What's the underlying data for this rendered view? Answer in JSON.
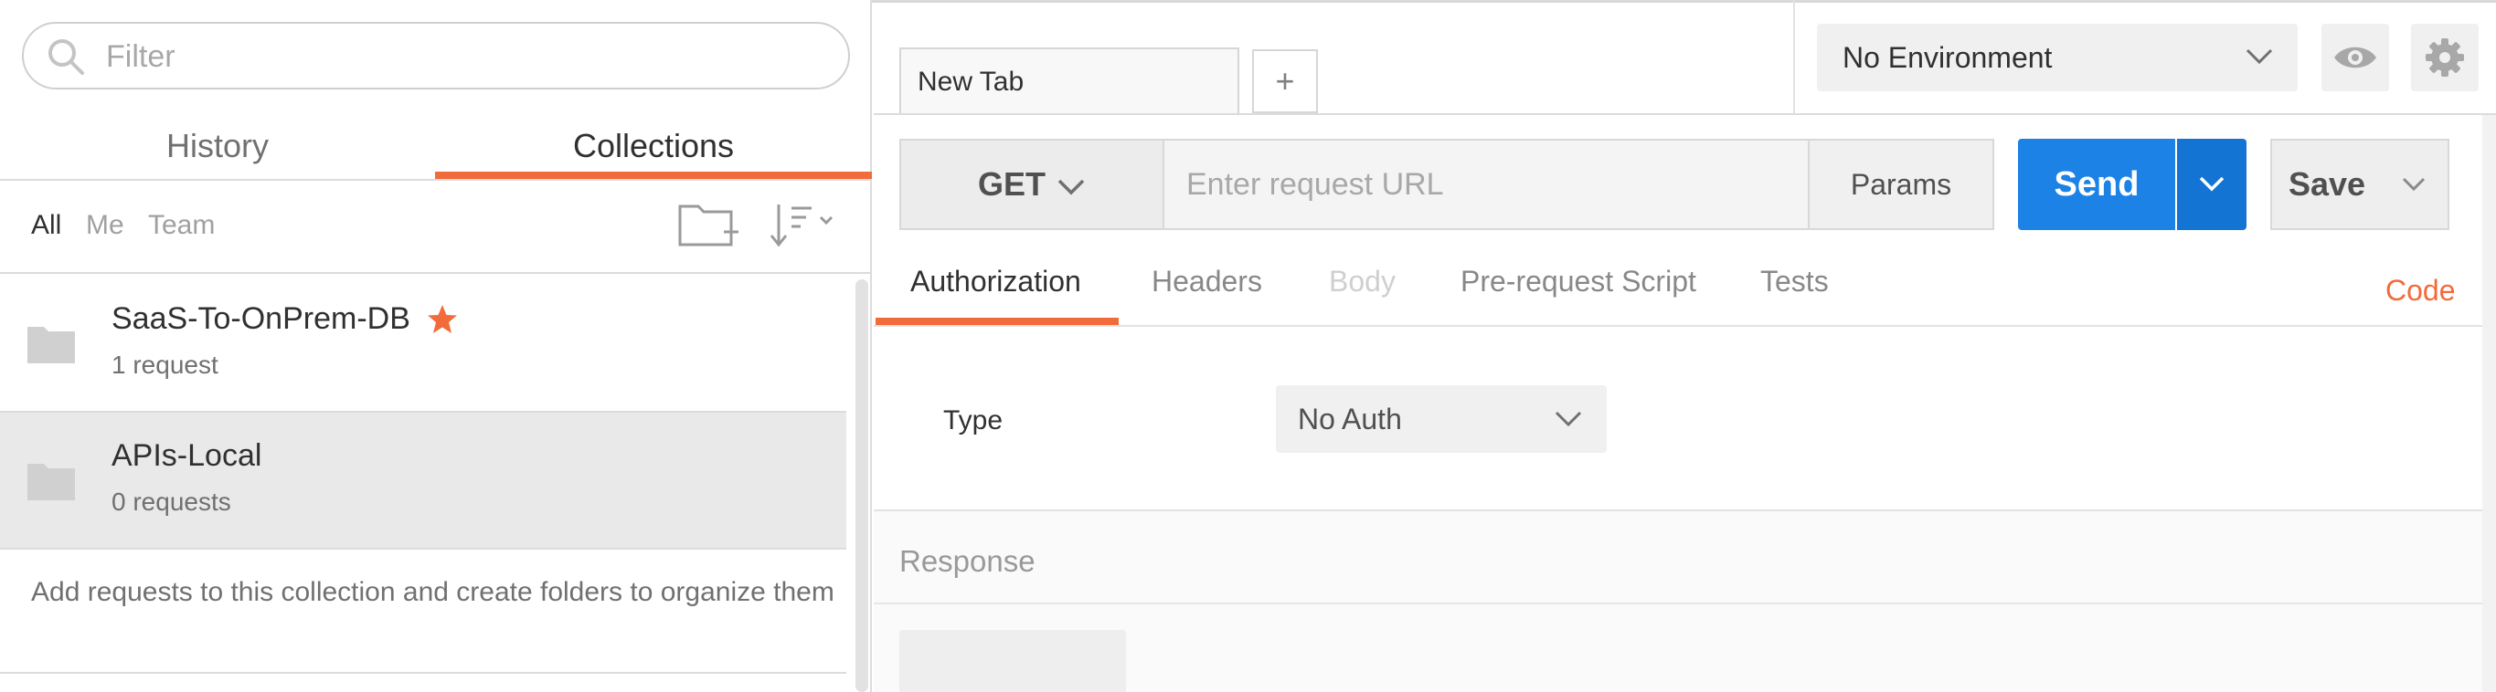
{
  "sidebar": {
    "filter_placeholder": "Filter",
    "tabs": {
      "history": "History",
      "collections": "Collections",
      "active": "collections"
    },
    "filters": {
      "all": "All",
      "me": "Me",
      "team": "Team"
    },
    "collections": [
      {
        "name": "SaaS-To-OnPrem-DB",
        "sub": "1 request",
        "starred": true
      },
      {
        "name": "APIs-Local",
        "sub": "0 requests",
        "starred": false
      }
    ],
    "hint": "Add requests to this collection and create folders to organize them"
  },
  "tabs": {
    "current": "New Tab",
    "add_symbol": "+"
  },
  "environment": {
    "selected": "No Environment"
  },
  "request": {
    "method": "GET",
    "url_placeholder": "Enter request URL",
    "params_label": "Params",
    "send_label": "Send",
    "save_label": "Save"
  },
  "request_tabs": {
    "authorization": "Authorization",
    "headers": "Headers",
    "body": "Body",
    "prerequest": "Pre-request Script",
    "tests": "Tests",
    "code": "Code"
  },
  "auth": {
    "type_label": "Type",
    "selected": "No Auth"
  },
  "response": {
    "label": "Response"
  },
  "colors": {
    "accent": "#f26b3a",
    "send": "#1c82e6",
    "star": "#f26b3a"
  }
}
